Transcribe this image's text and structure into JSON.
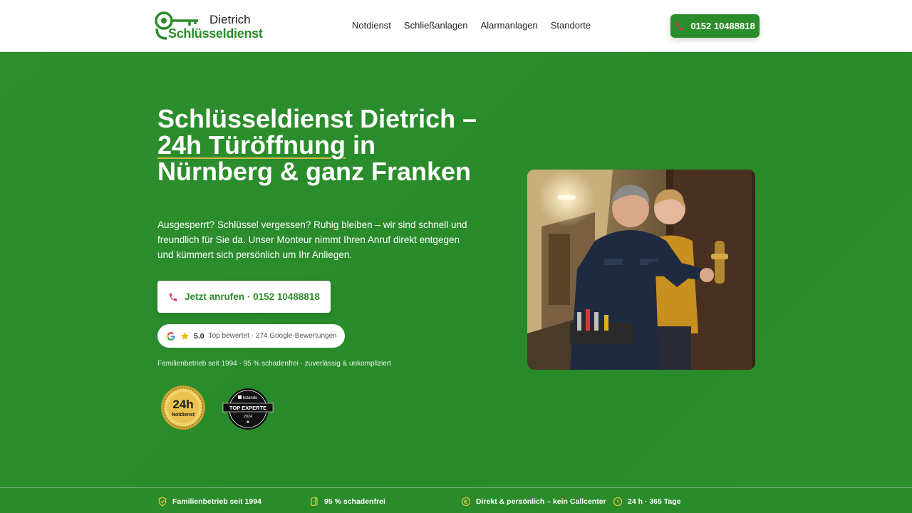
{
  "header": {
    "brand_top": "Dietrich",
    "brand_main": "Schlüsseldienst",
    "nav": [
      "Notdienst",
      "Schließanlagen",
      "Alarmanlagen",
      "Standorte"
    ],
    "cta_phone": "0152 10488818"
  },
  "hero": {
    "title_part1": "Schlüsseldienst Dietrich – ",
    "title_highlight": "24h Türöffnung",
    "title_part2": " in Nürnberg & ganz Franken",
    "subtitle": "Ausgesperrt? Schlüssel vergessen? Ruhig bleiben – wir sind schnell und freundlich für Sie da. Unser Monteur nimmt Ihren Anruf direkt entgegen und kümmert sich persönlich um Ihr Anliegen.",
    "cta_label": "Jetzt anrufen · 0152 10488818",
    "rating_score": "5.0",
    "rating_text": "Top bewertet · 274 Google-Bewertungen",
    "tagline": "Familienbetrieb seit 1994 · 95 % schadenfrei · zuverlässig & unkompliziert",
    "badge_24_big": "24h",
    "badge_24_small": "Notdienst",
    "badge_top_brand": "listando",
    "badge_top_title": "TOP EXPERTE",
    "badge_top_year": "2024"
  },
  "strip": {
    "items": [
      {
        "label": "Familienbetrieb seit 1994",
        "icon": "shield-check-icon"
      },
      {
        "label": "95 % schadenfrei",
        "icon": "door-icon"
      },
      {
        "label": "Direkt & persönlich – kein Callcenter",
        "icon": "euro-coin-icon"
      },
      {
        "label": "24 h · 365 Tage",
        "icon": "clock-icon"
      }
    ]
  },
  "colors": {
    "brand_green": "#2b8c2b",
    "accent_gold": "#d6b84a",
    "phone_pink": "#d6336c"
  }
}
